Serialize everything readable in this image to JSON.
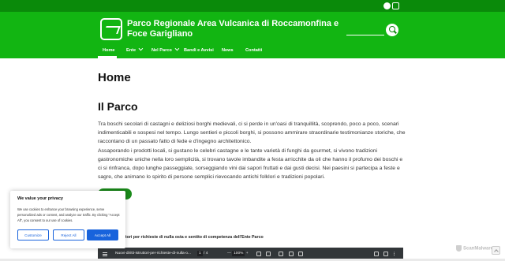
{
  "colors": {
    "topbar": "#0a8a0a",
    "header": "#12b512",
    "accent_button": "#1863dc",
    "pdf_toolbar": "#323639"
  },
  "topbar": {
    "social_icons": [
      "facebook-icon",
      "instagram-icon"
    ]
  },
  "header": {
    "site_title": "Parco Regionale Area Vulcanica di Roccamonfina e Foce Garigliano",
    "logo_icon": "park-logo-icon",
    "search_icon": "search-icon"
  },
  "nav": {
    "items": [
      {
        "label": "Home",
        "active": true,
        "dropdown": false
      },
      {
        "label": "Ente",
        "active": false,
        "dropdown": true
      },
      {
        "label": "Nel Parco",
        "active": false,
        "dropdown": true
      },
      {
        "label": "Bandi e Avvisi",
        "active": false,
        "dropdown": false
      },
      {
        "label": "News",
        "active": false,
        "dropdown": false
      },
      {
        "label": "Contatti",
        "active": false,
        "dropdown": false
      }
    ]
  },
  "main": {
    "page_title": "Home",
    "section_title": "Il Parco",
    "paragraph1": "Tra boschi secolari di castagni e deliziosi borghi medievali, ci si perde in un'oasi di tranquillità, scoprendo, poco a poco, scenari indimenticabili e sospesi nel tempo. Lungo sentieri e piccoli borghi, si possono ammirare straordinarie testimonianze storiche, che raccontano di un passato fatto di fede e d'ingegno architettonico.",
    "paragraph2": "Assaporando i prodotti locali, si gustano le celebri castagne e le tante varietà di funghi da gourmet, si vivono tradizioni gastronomiche uniche nella loro semplicità, si trovano tavole imbandite a festa arricchite da oli che hanno il profumo dei boschi e ci si rinfranca, dopo lunghe passeggiate, sorseggiando vini dai sapori fruttati e dai gusti decisi. Nei paesini si partecipa a feste e sagre, che animano lo spirito di persone semplici rievocando antichi folklori e tradizioni popolari.",
    "doc_title": "truttori per richieste di nulla osta e sentito di competenza dell'Ente Parco"
  },
  "pdf_viewer": {
    "filename": "Nuovi-diritti-istruttori-per-richieste-di-nulla-o...",
    "current_page": "1",
    "page_sep": "/",
    "total_pages": "4",
    "zoom": "100%"
  },
  "cookie_banner": {
    "title": "We value your privacy",
    "text": "We use cookies to enhance your browsing experience, serve personalized ads or content, and analyze our traffic. By clicking \"Accept All\", you consent to our use of cookies.",
    "customize_label": "Customize",
    "reject_label": "Reject All",
    "accept_label": "Accept All"
  },
  "watermark": {
    "text": "ScanMalware"
  }
}
